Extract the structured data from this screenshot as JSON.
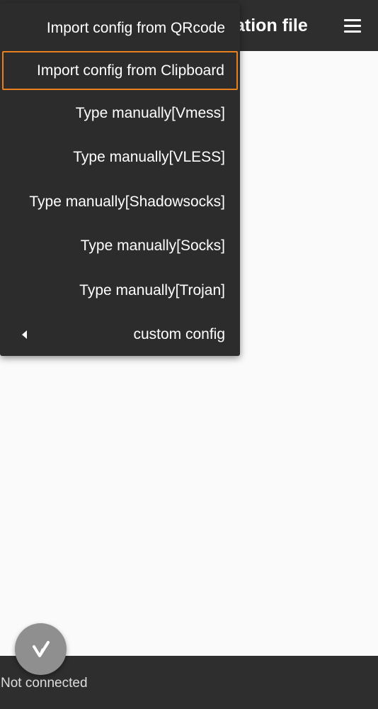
{
  "app_bar": {
    "title_visible": "ation file",
    "menu_icon": "hamburger-menu-icon"
  },
  "popup_menu": {
    "items": [
      {
        "label": "Import config from QRcode"
      },
      {
        "label": "Import config from Clipboard",
        "highlighted": true
      },
      {
        "label": "Type manually[Vmess]"
      },
      {
        "label": "Type manually[VLESS]"
      },
      {
        "label": "Type manually[Shadowsocks]"
      },
      {
        "label": "Type manually[Socks]"
      },
      {
        "label": "Type manually[Trojan]"
      },
      {
        "label": "custom config",
        "has_submenu": true,
        "submenu_icon": "chevron-left-icon"
      }
    ]
  },
  "fab": {
    "icon": "v-logo-icon"
  },
  "status_bar": {
    "text": "Not connected"
  },
  "colors": {
    "app_bar_bg": "#2e2e2e",
    "menu_bg": "#2c2c2c",
    "highlight_border": "#e8801f",
    "content_bg": "#fafafa",
    "fab_bg": "#8f8f8f"
  }
}
